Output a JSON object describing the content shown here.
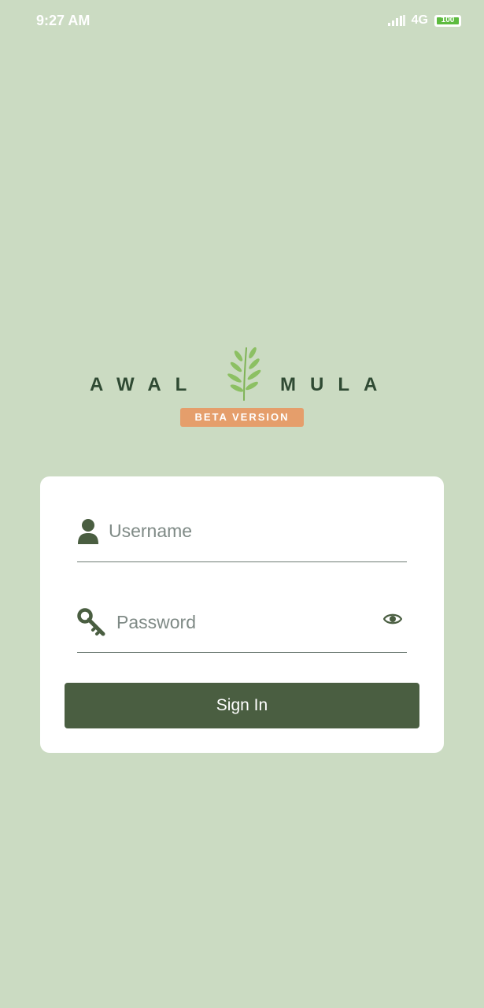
{
  "status_bar": {
    "time": "9:27 AM",
    "network": "4G",
    "battery": "100"
  },
  "logo": {
    "left_word": "AWAL",
    "right_word": "MULA",
    "badge": "BETA VERSION",
    "icon": "leaf-sprig-icon"
  },
  "form": {
    "username": {
      "placeholder": "Username",
      "value": "",
      "icon": "user-icon"
    },
    "password": {
      "placeholder": "Password",
      "value": "",
      "icon": "key-icon",
      "toggle_icon": "eye-icon"
    },
    "submit_label": "Sign In"
  },
  "colors": {
    "background": "#cbdbc2",
    "primary": "#4a5e41",
    "badge": "#e59e6b",
    "logo_text": "#2f4a33"
  }
}
